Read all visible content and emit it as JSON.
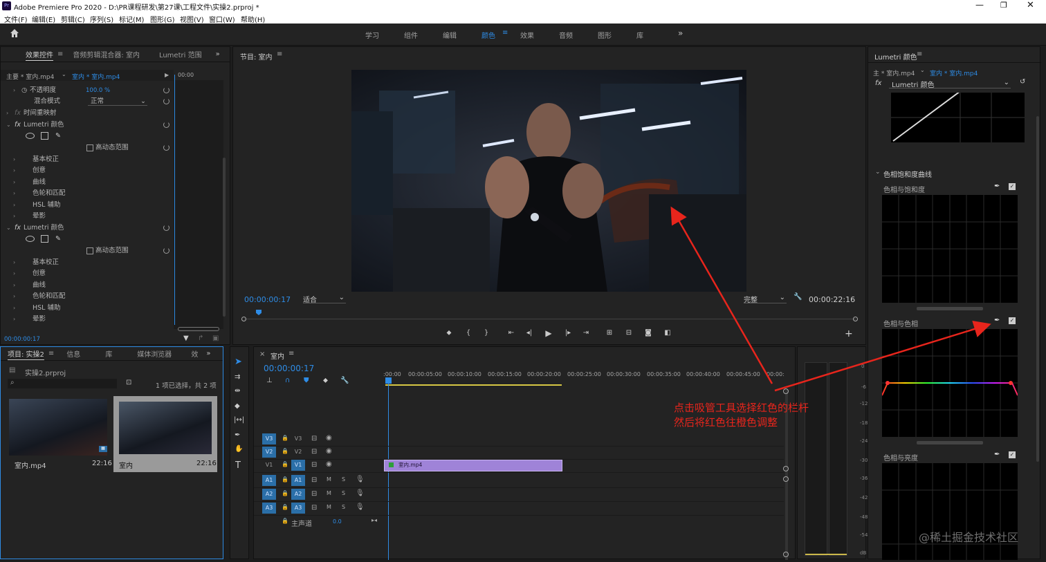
{
  "window": {
    "title": "Adobe Premiere Pro 2020 - D:\\PR课程研发\\第27课\\工程文件\\实操2.prproj *",
    "app_icon": "Pr"
  },
  "menu": [
    "文件(F)",
    "编辑(E)",
    "剪辑(C)",
    "序列(S)",
    "标记(M)",
    "图形(G)",
    "视图(V)",
    "窗口(W)",
    "帮助(H)"
  ],
  "workspaces": [
    "学习",
    "组件",
    "编辑",
    "颜色",
    "效果",
    "音频",
    "图形",
    "库"
  ],
  "active_workspace": "颜色",
  "effect_controls": {
    "tabs": [
      "效果控件",
      "音频剪辑混合器: 室内",
      "Lumetri 范围"
    ],
    "master": "主要 * 室内.mp4",
    "clip": "室内 * 室内.mp4",
    "timecode_start": "00:00",
    "opacity_label": "不透明度",
    "opacity_value": "100.0 %",
    "blend_label": "混合模式",
    "blend_value": "正常",
    "time_remap": "时间重映射",
    "lumetri1": "Lumetri 颜色",
    "hdr1": "高动态范围",
    "sections1": [
      "基本校正",
      "创意",
      "曲线",
      "色轮和匹配",
      "HSL 辅助",
      "晕影"
    ],
    "lumetri2": "Lumetri 颜色",
    "hdr2": "高动态范围",
    "sections2": [
      "基本校正",
      "创意",
      "曲线",
      "色轮和匹配",
      "HSL 辅助",
      "晕影"
    ],
    "bottom_timecode": "00:00:00:17"
  },
  "program": {
    "title": "节目: 室内",
    "timecode": "00:00:00:17",
    "fit": "适合",
    "quality": "完整",
    "duration": "00:00:22:16"
  },
  "lumetri": {
    "title": "Lumetri 颜色",
    "master": "主 * 室内.mp4",
    "clip": "室内 * 室内.mp4",
    "effect": "Lumetri 颜色",
    "section": "色相饱和度曲线",
    "curve1": "色相与饱和度",
    "curve2": "色相与色相",
    "curve3": "色相与亮度"
  },
  "project": {
    "tabs": [
      "项目: 实操2",
      "信息",
      "库",
      "媒体浏览器",
      "效"
    ],
    "file": "实操2.prproj",
    "status": "1 项已选择，共 2 项",
    "items": [
      {
        "name": "室内.mp4",
        "duration": "22:16"
      },
      {
        "name": "室内",
        "duration": "22:16"
      }
    ]
  },
  "timeline": {
    "tab": "室内",
    "timecode": "00:00:00:17",
    "ruler": [
      ":00:00",
      "00:00:05:00",
      "00:00:10:00",
      "00:00:15:00",
      "00:00:20:00",
      "00:00:25:00",
      "00:00:30:00",
      "00:00:35:00",
      "00:00:40:00",
      "00:00:45:00",
      "00:00:"
    ],
    "video_tracks": [
      "V3",
      "V2",
      "V1"
    ],
    "audio_tracks": [
      "A1",
      "A2",
      "A3"
    ],
    "master_label": "主声道",
    "master_value": "0.0",
    "clip": "室内.mp4",
    "mute": "M",
    "solo": "S"
  },
  "meter_db": [
    "0",
    "-6",
    "-12",
    "-18",
    "-24",
    "-30",
    "-36",
    "-42",
    "-48",
    "-54",
    "dB"
  ],
  "annotation": {
    "line1": "点击吸管工具选择红色的栏杆",
    "line2": "然后将红色往橙色调整"
  },
  "watermark": "@稀土掘金技术社区",
  "colors": {
    "accent": "#2e8ce6",
    "annotation": "#e8251c",
    "clip": "#9f83d8"
  }
}
